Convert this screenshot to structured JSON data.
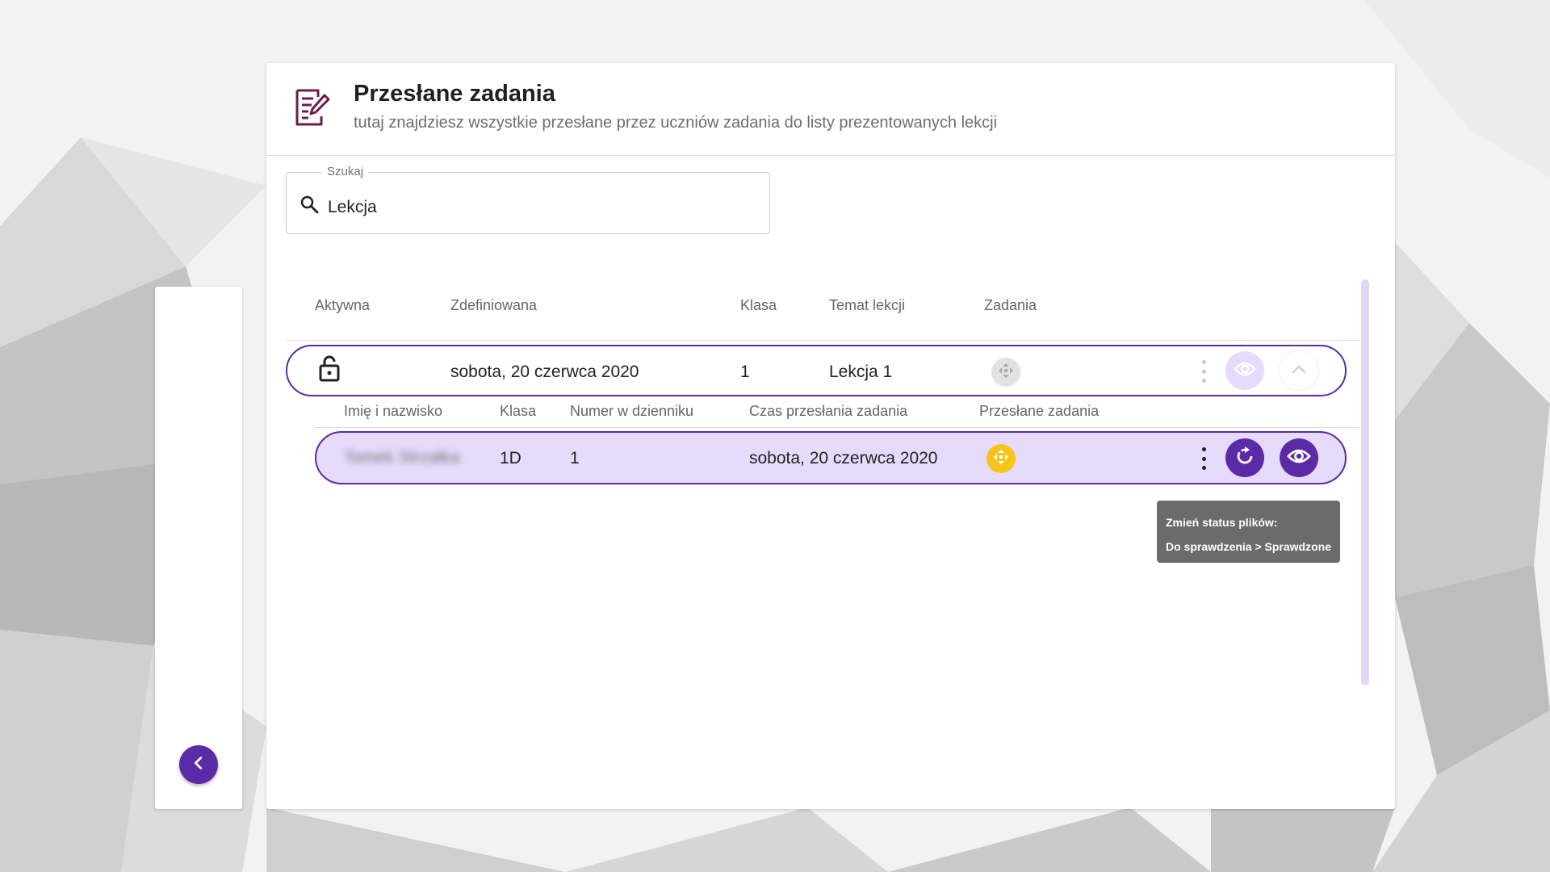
{
  "header": {
    "title": "Przesłane zadania",
    "subtitle": "tutaj znajdziesz wszystkie przesłane przez uczniów zadania do listy prezentowanych lekcji"
  },
  "search": {
    "label": "Szukaj",
    "value": "Lekcja"
  },
  "table": {
    "headers": {
      "active": "Aktywna",
      "defined": "Zdefiniowana",
      "class": "Klasa",
      "topic": "Temat lekcji",
      "tasks": "Zadania"
    },
    "lesson": {
      "defined": "sobota, 20 czerwca 2020",
      "class": "1",
      "topic": "Lekcja 1"
    }
  },
  "submissions": {
    "headers": {
      "name": "Imię i nazwisko",
      "class": "Klasa",
      "number": "Numer w dzienniku",
      "time": "Czas przesłania zadania",
      "files": "Przesłane zadania"
    },
    "row": {
      "name": "Tomek Strzałka",
      "class": "1D",
      "number": "1",
      "time": "sobota, 20 czerwca 2020"
    }
  },
  "tooltip": {
    "line1": "Zmień status plików:",
    "line2": "Do sprawdzenia > Sprawdzone"
  },
  "colors": {
    "accent": "#5b2aa6",
    "row_highlight": "#e6dbfa",
    "status_yellow": "#f5c518",
    "icon_brand": "#6a1f4f"
  },
  "icons": {
    "header": "edit-document-icon",
    "search": "search-icon",
    "active": "unlock-icon",
    "tasks": "move-arrows-icon",
    "change_status": "refresh-icon",
    "view": "eye-icon",
    "expand": "chevron-up-icon",
    "collapse_panel": "chevron-left-icon"
  }
}
